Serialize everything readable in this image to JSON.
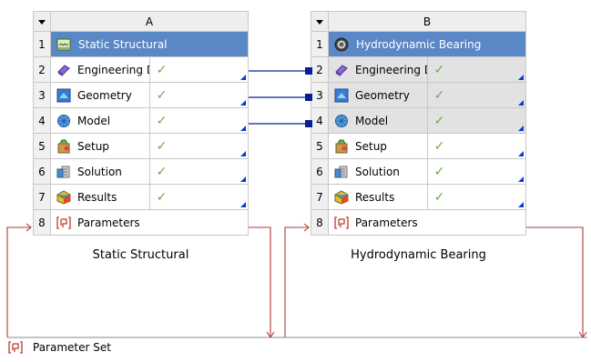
{
  "systems": [
    {
      "column": "A",
      "caption": "Static Structural",
      "rows": [
        {
          "num": "1",
          "label": "Static Structural",
          "icon": "static-structural-icon",
          "status": "",
          "title": true
        },
        {
          "num": "2",
          "label": "Engineering Data",
          "icon": "engineering-data-icon",
          "status": "✓"
        },
        {
          "num": "3",
          "label": "Geometry",
          "icon": "geometry-icon",
          "status": "✓"
        },
        {
          "num": "4",
          "label": "Model",
          "icon": "model-icon",
          "status": "✓"
        },
        {
          "num": "5",
          "label": "Setup",
          "icon": "setup-icon",
          "status": "✓"
        },
        {
          "num": "6",
          "label": "Solution",
          "icon": "solution-icon",
          "status": "✓"
        },
        {
          "num": "7",
          "label": "Results",
          "icon": "results-icon",
          "status": "✓"
        },
        {
          "num": "8",
          "label": "Parameters",
          "icon": "parameters-icon",
          "status": ""
        }
      ]
    },
    {
      "column": "B",
      "caption": "Hydrodynamic Bearing",
      "rows": [
        {
          "num": "1",
          "label": "Hydrodynamic Bearing",
          "icon": "hydrodynamic-bearing-icon",
          "status": "",
          "title": true
        },
        {
          "num": "2",
          "label": "Engineering Data",
          "icon": "engineering-data-icon",
          "status": "✓"
        },
        {
          "num": "3",
          "label": "Geometry",
          "icon": "geometry-icon",
          "status": "✓"
        },
        {
          "num": "4",
          "label": "Model",
          "icon": "model-icon",
          "status": "✓"
        },
        {
          "num": "5",
          "label": "Setup",
          "icon": "setup-icon",
          "status": "✓"
        },
        {
          "num": "6",
          "label": "Solution",
          "icon": "solution-icon",
          "status": "✓"
        },
        {
          "num": "7",
          "label": "Results",
          "icon": "results-icon",
          "status": "✓"
        },
        {
          "num": "8",
          "label": "Parameters",
          "icon": "parameters-icon",
          "status": ""
        }
      ]
    }
  ],
  "parameter_set": {
    "label": "Parameter Set",
    "icon": "parameters-icon"
  },
  "colors": {
    "title_row": "#5a88c6",
    "check": "#6aa84f",
    "link_line": "#0a1f8f",
    "param_line": "#b03a3a",
    "shared_cell": "#e2e2e2"
  }
}
